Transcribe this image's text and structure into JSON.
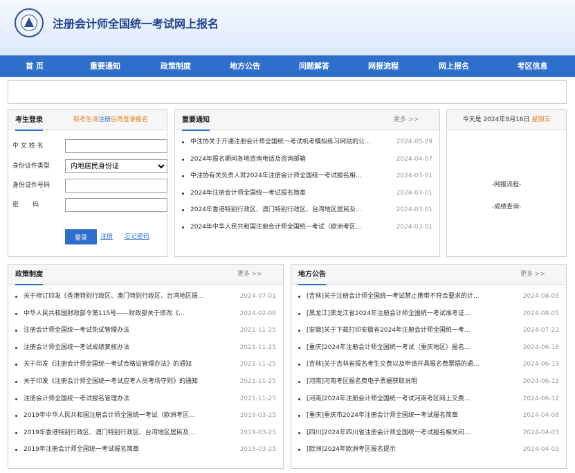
{
  "header": {
    "title": "注册会计师全国统一考试网上报名"
  },
  "nav": [
    "首 页",
    "重要通知",
    "政策制度",
    "地方公告",
    "问题解答",
    "网报流程",
    "网上报名",
    "考区信息"
  ],
  "login": {
    "title": "考生登录",
    "tip_pre": "新考生请",
    "tip_link": "注册",
    "tip_post": "后再登录报名",
    "name_label": "中 文  姓 名",
    "idtype_label": "身份证件类型",
    "idtype_value": "内地居民身份证",
    "idno_label": "身份证件号码",
    "pwd_label": "密       码",
    "login_btn": "登录",
    "register_link": "注册",
    "forgot_link": "忘记密码"
  },
  "notice": {
    "title": "重要通知",
    "more": "更多 >>",
    "items": [
      {
        "t": "中注协关于开通注册会计师全国统一考试机考模拟练习网站的公...",
        "d": "2024-05-29"
      },
      {
        "t": "2024年报名期间各地咨询电话及咨询邮箱",
        "d": "2024-04-07"
      },
      {
        "t": "中注协有关负责人就2024年注册会计师全国统一考试报名相...",
        "d": "2024-03-01"
      },
      {
        "t": "2024年注册会计师全国统一考试报名简章",
        "d": "2024-03-01"
      },
      {
        "t": "2024年香港特别行政区、澳门特别行政区、台湾地区居民及...",
        "d": "2024-03-01"
      },
      {
        "t": "2024年中华人民共和国注册会计师全国统一考试（欧洲考区...",
        "d": "2024-03-01"
      }
    ]
  },
  "side": {
    "date_pre": "今天是 2024年8月16日",
    "weekday": "星期五",
    "link1": "-网报流程-",
    "link2": "-成绩查询-"
  },
  "policy": {
    "title": "政策制度",
    "more": "更多 >>",
    "items": [
      {
        "t": "关于修订印发《香港特别行政区、澳门特别行政区、台湾地区居...",
        "d": "2024-07-01"
      },
      {
        "t": "中华人民共和国财政部令第115号——财政部关于修改《...",
        "d": "2024-02-08"
      },
      {
        "t": "注册会计师全国统一考试免试管理办法",
        "d": "2021-11-25"
      },
      {
        "t": "注册会计师全国统一考试成绩复核办法",
        "d": "2021-11-25"
      },
      {
        "t": "关于印发《注册会计师全国统一考试合格证管理办法》的通知",
        "d": "2021-11-25"
      },
      {
        "t": "关于印发《注册会计师全国统一考试应考人员考场守则》的通知",
        "d": "2021-11-25"
      },
      {
        "t": "注册会计师全国统一考试报名管理办法",
        "d": "2021-11-25"
      },
      {
        "t": "2019年中华人民共和国注册会计师全国统一考试（欧洲考区...",
        "d": "2019-03-25"
      },
      {
        "t": "2019年香港特别行政区、澳门特别行政区、台湾地区居民及...",
        "d": "2019-03-25"
      },
      {
        "t": "2019年注册会计师全国统一考试报名简章",
        "d": "2019-03-25"
      }
    ]
  },
  "local": {
    "title": "地方公告",
    "more": "更多 >>",
    "items": [
      {
        "t": "[吉林]关于注册会计师全国统一考试禁止携带不符合要求的计...",
        "d": "2024-08-09"
      },
      {
        "t": "[黑龙江]黑龙江省2024年注册会计师全国统一考试准考证...",
        "d": "2024-08-05"
      },
      {
        "t": "[安徽]关于下载打印安徽省2024年注册会计师全国统一考...",
        "d": "2024-07-22"
      },
      {
        "t": "[重庆]2024年注册会计师全国统一考试（重庆地区）报名...",
        "d": "2024-06-18"
      },
      {
        "t": "[吉林]关于吉林省报名考生交费以及申请开具报名费票据的通...",
        "d": "2024-06-13"
      },
      {
        "t": "[河南]河南考区报名费电子票据获取说明",
        "d": "2024-06-12"
      },
      {
        "t": "[河南]2024年注册会计师全国统一考试河南考区网上交费...",
        "d": "2024-06-12"
      },
      {
        "t": "[重庆]重庆市2024年注册会计师全国统一考试报名简章",
        "d": "2024-04-08"
      },
      {
        "t": "[四川]2024年四川省注册会计师全国统一考试报名相关问...",
        "d": "2024-04-03"
      },
      {
        "t": "[欧洲]2024年欧洲考区报名提示",
        "d": "2024-04-02"
      }
    ]
  }
}
